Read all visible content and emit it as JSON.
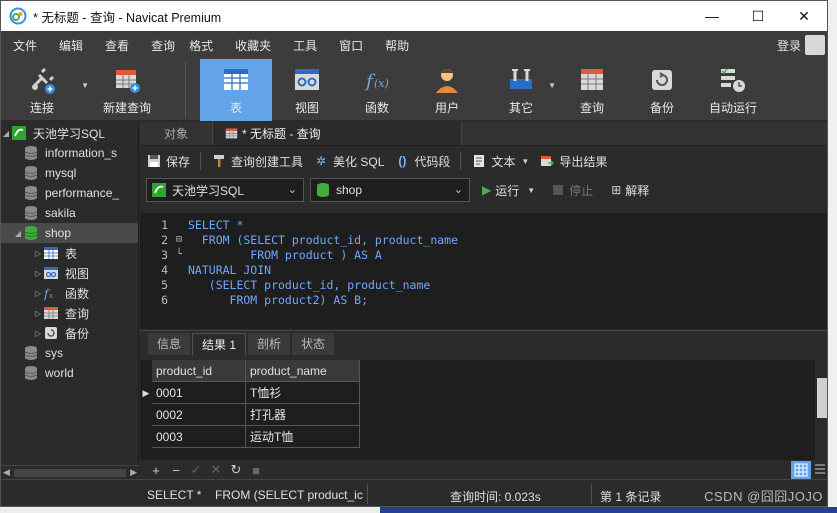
{
  "window": {
    "title": "* 无标题 - 查询 - Navicat Premium",
    "minimize": "—",
    "maximize": "☐",
    "close": "✕"
  },
  "menu": {
    "items": [
      "文件",
      "编辑",
      "查看",
      "查询",
      "格式",
      "收藏夹",
      "工具",
      "窗口",
      "帮助"
    ],
    "login": "登录"
  },
  "toolbar": {
    "items": [
      {
        "label": "连接",
        "icon": "plug-icon"
      },
      {
        "label": "新建查询",
        "icon": "new-query-icon"
      },
      {
        "label": "表",
        "icon": "table-icon",
        "active": true
      },
      {
        "label": "视图",
        "icon": "view-icon"
      },
      {
        "label": "函数",
        "icon": "function-icon"
      },
      {
        "label": "用户",
        "icon": "user-icon"
      },
      {
        "label": "其它",
        "icon": "tools-icon"
      },
      {
        "label": "查询",
        "icon": "query-icon"
      },
      {
        "label": "备份",
        "icon": "backup-icon"
      },
      {
        "label": "自动运行",
        "icon": "schedule-icon"
      }
    ]
  },
  "sidebar": {
    "connection": "天池学习SQL",
    "databases": [
      "information_s",
      "mysql",
      "performance_",
      "sakila",
      "shop"
    ],
    "shop_children": [
      "表",
      "视图",
      "函数",
      "查询",
      "备份"
    ],
    "other_databases": [
      "sys",
      "world"
    ]
  },
  "tabs": {
    "objects": "对象",
    "query": "* 无标题 - 查询"
  },
  "query_toolbar": {
    "save": "保存",
    "builder": "查询创建工具",
    "beautify": "美化 SQL",
    "snippet": "代码段",
    "text": "文本",
    "export": "导出结果"
  },
  "selectors": {
    "connection": "天池学习SQL",
    "database": "shop",
    "run": "运行",
    "stop": "停止",
    "explain": "解释"
  },
  "editor": {
    "lines": [
      {
        "n": "1",
        "code": "SELECT *",
        "fold": ""
      },
      {
        "n": "2",
        "code": "  FROM (SELECT product_id, product_name",
        "fold": "⊟"
      },
      {
        "n": "3",
        "code": "         FROM product ) AS A",
        "fold": "└"
      },
      {
        "n": "4",
        "code": "NATURAL JOIN",
        "fold": ""
      },
      {
        "n": "5",
        "code": "   (SELECT product_id, product_name",
        "fold": ""
      },
      {
        "n": "6",
        "code": "      FROM product2) AS B;",
        "fold": ""
      }
    ]
  },
  "result_tabs": [
    "信息",
    "结果 1",
    "剖析",
    "状态"
  ],
  "results": {
    "columns": [
      "product_id",
      "product_name"
    ],
    "rows": [
      [
        "0001",
        "T恤衫"
      ],
      [
        "0002",
        "打孔器"
      ],
      [
        "0003",
        "运动T恤"
      ]
    ]
  },
  "grid_toolbar": [
    "+",
    "−",
    "✓",
    "✕",
    "↻",
    "■"
  ],
  "status": {
    "sql": "SELECT *",
    "sql_preview": "FROM (SELECT product_ic",
    "query_time": "查询时间: 0.023s",
    "record": "第 1 条记录"
  },
  "watermark": "CSDN @囧囧JOJO",
  "colors": {
    "accent": "#63a4e8",
    "keyword": "#6fa8ff",
    "db_green": "#3fae3f"
  }
}
